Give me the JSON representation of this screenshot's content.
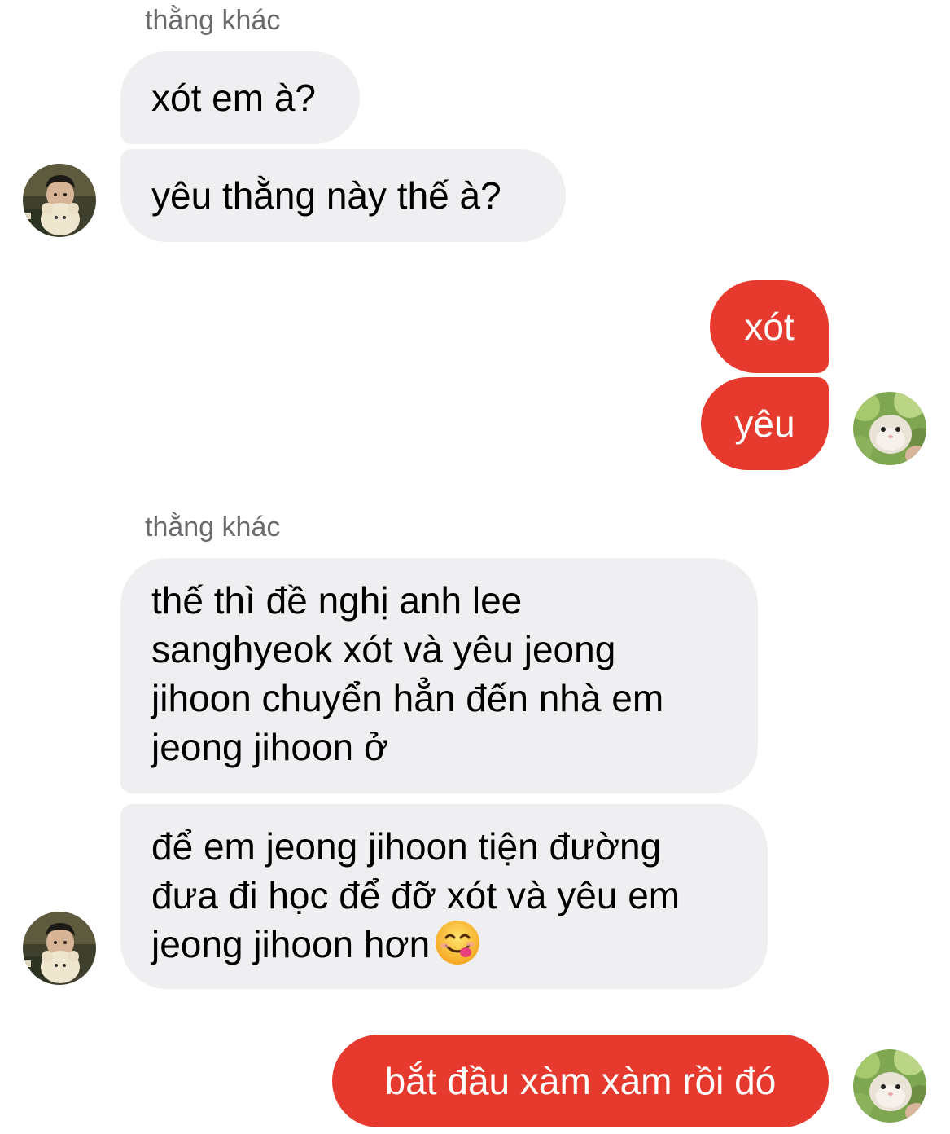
{
  "conversation": {
    "groups": [
      {
        "sender": "thằng khác",
        "messages": [
          {
            "text": "xót em à?"
          },
          {
            "text": "yêu thằng này thế à?"
          }
        ]
      },
      {
        "sender": "me",
        "messages": [
          {
            "text": "xót"
          },
          {
            "text": "yêu"
          }
        ]
      },
      {
        "sender": "thằng khác",
        "messages": [
          {
            "lines": [
              "thế thì đề nghị anh lee",
              "sanghyeok xót và yêu jeong",
              "jihoon chuyển hẳn đến nhà em",
              "jeong jihoon ở"
            ]
          },
          {
            "lines": [
              "để em jeong jihoon tiện đường",
              "đưa đi học để đỡ xót và yêu em",
              "jeong jihoon hơn"
            ],
            "emoji": "face-savoring-food"
          }
        ]
      },
      {
        "sender": "me",
        "messages": [
          {
            "text": "bắt đầu xàm xàm rồi đó"
          }
        ]
      }
    ]
  },
  "colors": {
    "incoming_bubble": "#efeff2",
    "outgoing_bubble": "#e73a2f",
    "sender_name": "#6b6b6f"
  },
  "avatars": {
    "other": "child-with-teddy-bear-photo",
    "me": "hamster-in-lettuce-photo"
  }
}
